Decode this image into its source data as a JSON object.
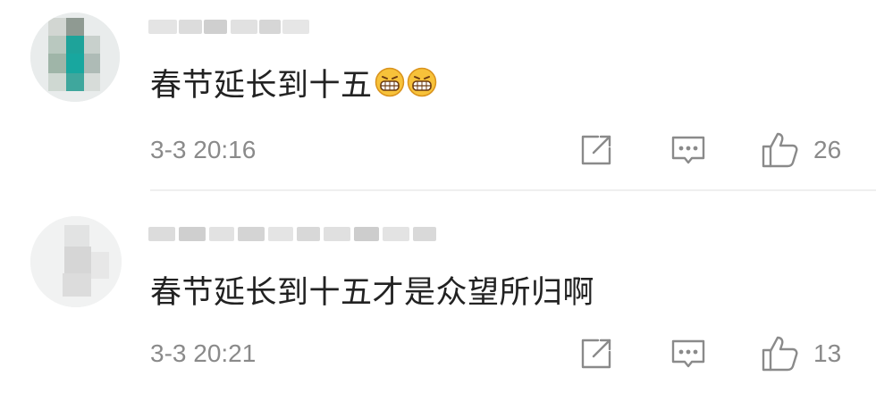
{
  "comments": [
    {
      "text": "春节延长到十五",
      "emojis": [
        "grinning-face-emoji",
        "grinning-face-emoji"
      ],
      "time": "3-3 20:16",
      "like_count": "26"
    },
    {
      "text": "春节延长到十五才是众望所归啊",
      "emojis": [],
      "time": "3-3 20:21",
      "like_count": "13"
    }
  ],
  "icons": {
    "share": "share-icon",
    "reply": "comment-icon",
    "like": "thumbs-up-icon"
  },
  "colors": {
    "text": "#222222",
    "meta": "#8a8a8a",
    "divider": "#efefef",
    "background": "#ffffff"
  }
}
